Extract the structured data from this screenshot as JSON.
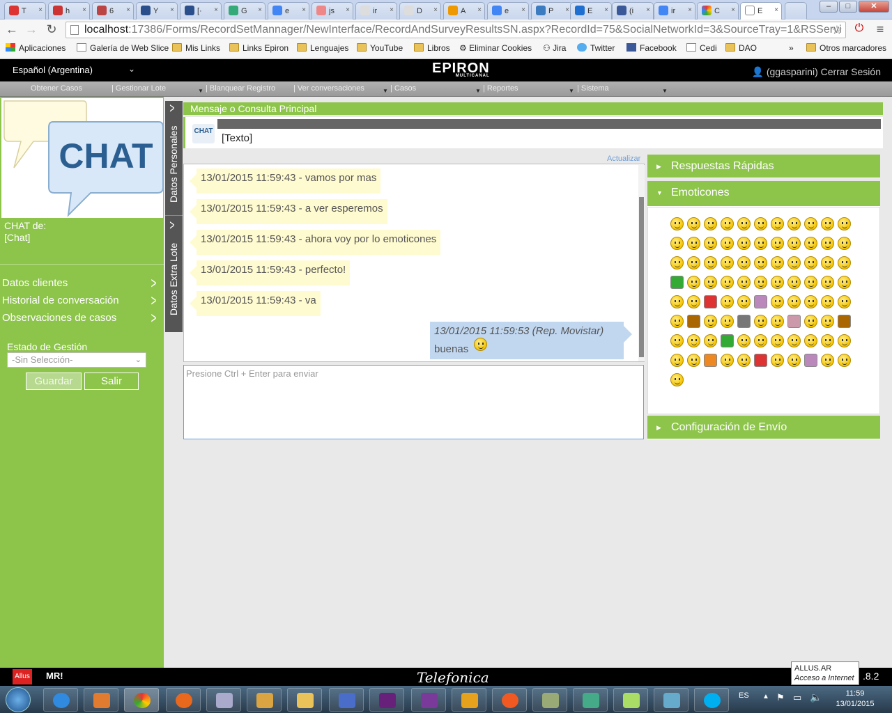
{
  "browser": {
    "tabs": [
      "T",
      "h",
      "6",
      "Y",
      "[·",
      "G",
      "e",
      "js",
      "ir",
      "D",
      "A",
      "e",
      "P",
      "E",
      "(i",
      "ir",
      "C",
      "E"
    ],
    "url_host": "localhost",
    "url_rest": ":17386/Forms/RecordSetMannager/NewInterface/RecordAndSurveyResultsSN.aspx?RecordId=75&SocialNetworkId=3&SourceTray=1&RSServi",
    "bookmarks": [
      "Aplicaciones",
      "Galería de Web Slice",
      "Mis Links",
      "Links Epiron",
      "Lenguajes",
      "YouTube",
      "Libros",
      "Eliminar Cookies",
      "Jira",
      "Twitter",
      "Facebook",
      "Cedi",
      "DAO",
      "»",
      "Otros marcadores"
    ]
  },
  "header": {
    "language": "Español (Argentina)",
    "logo": "EPIRON",
    "logo_sub": "MULTICANAL",
    "user": "(ggasparini) Cerrar Sesión"
  },
  "menu": [
    "Obtener Casos",
    "Gestionar Lote",
    "Blanquear Registro",
    "Ver conversaciones",
    "Casos",
    "Reportes",
    "Sistema"
  ],
  "sidebar": {
    "chat_logo": "CHAT",
    "chat_de": "CHAT de:",
    "chat_name": "[Chat]",
    "links": [
      "Datos clientes",
      "Historial de conversación",
      "Observaciones de casos"
    ],
    "estado_label": "Estado de Gestión",
    "estado_value": "-Sin Selección-",
    "guardar": "Guardar",
    "salir": "Salir"
  },
  "vtabs": [
    "Datos Personales",
    "Datos Extra Lote"
  ],
  "main": {
    "title": "Mensaje o Consulta Principal",
    "chat_badge": "CHAT",
    "message": "[Texto]",
    "actualizar": "Actualizar",
    "messages": [
      "13/01/2015 11:59:43 - vamos por mas",
      "13/01/2015 11:59:43 - a ver esperemos",
      "13/01/2015 11:59:43 - ahora voy por lo emoticones",
      "13/01/2015 11:59:43 - perfecto!",
      "13/01/2015 11:59:43 - va"
    ],
    "rep_header": "13/01/2015 11:59:53 (Rep. Movistar)",
    "rep_text": "buenas",
    "input_placeholder": "Presione Ctrl + Enter para enviar"
  },
  "accordion": {
    "respuestas": "Respuestas Rápidas",
    "emoticones": "Emoticones",
    "config": "Configuración de Envío"
  },
  "statusbar": {
    "allus": "Allus",
    "mr": "MR!",
    "telefonica": "Telefonica",
    "version": ".8.2",
    "tooltip_title": "ALLUS.AR",
    "tooltip_sub": "Acceso a Internet"
  },
  "taskbar": {
    "lang": "ES",
    "time": "11:59",
    "date": "13/01/2015"
  },
  "colors": {
    "green": "#8dc44a",
    "bubble": "#fffbd0",
    "rep_bubble": "#c1d7f0"
  }
}
